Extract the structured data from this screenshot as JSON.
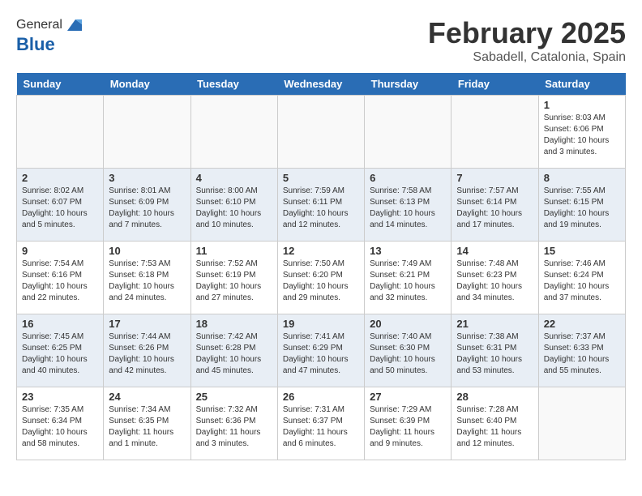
{
  "header": {
    "logo_general": "General",
    "logo_blue": "Blue",
    "month_title": "February 2025",
    "location": "Sabadell, Catalonia, Spain"
  },
  "days_of_week": [
    "Sunday",
    "Monday",
    "Tuesday",
    "Wednesday",
    "Thursday",
    "Friday",
    "Saturday"
  ],
  "weeks": [
    [
      {
        "day": "",
        "info": ""
      },
      {
        "day": "",
        "info": ""
      },
      {
        "day": "",
        "info": ""
      },
      {
        "day": "",
        "info": ""
      },
      {
        "day": "",
        "info": ""
      },
      {
        "day": "",
        "info": ""
      },
      {
        "day": "1",
        "info": "Sunrise: 8:03 AM\nSunset: 6:06 PM\nDaylight: 10 hours\nand 3 minutes."
      }
    ],
    [
      {
        "day": "2",
        "info": "Sunrise: 8:02 AM\nSunset: 6:07 PM\nDaylight: 10 hours\nand 5 minutes."
      },
      {
        "day": "3",
        "info": "Sunrise: 8:01 AM\nSunset: 6:09 PM\nDaylight: 10 hours\nand 7 minutes."
      },
      {
        "day": "4",
        "info": "Sunrise: 8:00 AM\nSunset: 6:10 PM\nDaylight: 10 hours\nand 10 minutes."
      },
      {
        "day": "5",
        "info": "Sunrise: 7:59 AM\nSunset: 6:11 PM\nDaylight: 10 hours\nand 12 minutes."
      },
      {
        "day": "6",
        "info": "Sunrise: 7:58 AM\nSunset: 6:13 PM\nDaylight: 10 hours\nand 14 minutes."
      },
      {
        "day": "7",
        "info": "Sunrise: 7:57 AM\nSunset: 6:14 PM\nDaylight: 10 hours\nand 17 minutes."
      },
      {
        "day": "8",
        "info": "Sunrise: 7:55 AM\nSunset: 6:15 PM\nDaylight: 10 hours\nand 19 minutes."
      }
    ],
    [
      {
        "day": "9",
        "info": "Sunrise: 7:54 AM\nSunset: 6:16 PM\nDaylight: 10 hours\nand 22 minutes."
      },
      {
        "day": "10",
        "info": "Sunrise: 7:53 AM\nSunset: 6:18 PM\nDaylight: 10 hours\nand 24 minutes."
      },
      {
        "day": "11",
        "info": "Sunrise: 7:52 AM\nSunset: 6:19 PM\nDaylight: 10 hours\nand 27 minutes."
      },
      {
        "day": "12",
        "info": "Sunrise: 7:50 AM\nSunset: 6:20 PM\nDaylight: 10 hours\nand 29 minutes."
      },
      {
        "day": "13",
        "info": "Sunrise: 7:49 AM\nSunset: 6:21 PM\nDaylight: 10 hours\nand 32 minutes."
      },
      {
        "day": "14",
        "info": "Sunrise: 7:48 AM\nSunset: 6:23 PM\nDaylight: 10 hours\nand 34 minutes."
      },
      {
        "day": "15",
        "info": "Sunrise: 7:46 AM\nSunset: 6:24 PM\nDaylight: 10 hours\nand 37 minutes."
      }
    ],
    [
      {
        "day": "16",
        "info": "Sunrise: 7:45 AM\nSunset: 6:25 PM\nDaylight: 10 hours\nand 40 minutes."
      },
      {
        "day": "17",
        "info": "Sunrise: 7:44 AM\nSunset: 6:26 PM\nDaylight: 10 hours\nand 42 minutes."
      },
      {
        "day": "18",
        "info": "Sunrise: 7:42 AM\nSunset: 6:28 PM\nDaylight: 10 hours\nand 45 minutes."
      },
      {
        "day": "19",
        "info": "Sunrise: 7:41 AM\nSunset: 6:29 PM\nDaylight: 10 hours\nand 47 minutes."
      },
      {
        "day": "20",
        "info": "Sunrise: 7:40 AM\nSunset: 6:30 PM\nDaylight: 10 hours\nand 50 minutes."
      },
      {
        "day": "21",
        "info": "Sunrise: 7:38 AM\nSunset: 6:31 PM\nDaylight: 10 hours\nand 53 minutes."
      },
      {
        "day": "22",
        "info": "Sunrise: 7:37 AM\nSunset: 6:33 PM\nDaylight: 10 hours\nand 55 minutes."
      }
    ],
    [
      {
        "day": "23",
        "info": "Sunrise: 7:35 AM\nSunset: 6:34 PM\nDaylight: 10 hours\nand 58 minutes."
      },
      {
        "day": "24",
        "info": "Sunrise: 7:34 AM\nSunset: 6:35 PM\nDaylight: 11 hours\nand 1 minute."
      },
      {
        "day": "25",
        "info": "Sunrise: 7:32 AM\nSunset: 6:36 PM\nDaylight: 11 hours\nand 3 minutes."
      },
      {
        "day": "26",
        "info": "Sunrise: 7:31 AM\nSunset: 6:37 PM\nDaylight: 11 hours\nand 6 minutes."
      },
      {
        "day": "27",
        "info": "Sunrise: 7:29 AM\nSunset: 6:39 PM\nDaylight: 11 hours\nand 9 minutes."
      },
      {
        "day": "28",
        "info": "Sunrise: 7:28 AM\nSunset: 6:40 PM\nDaylight: 11 hours\nand 12 minutes."
      },
      {
        "day": "",
        "info": ""
      }
    ]
  ],
  "row_bg": [
    "#ffffff",
    "#e8eef5",
    "#ffffff",
    "#e8eef5",
    "#ffffff"
  ]
}
